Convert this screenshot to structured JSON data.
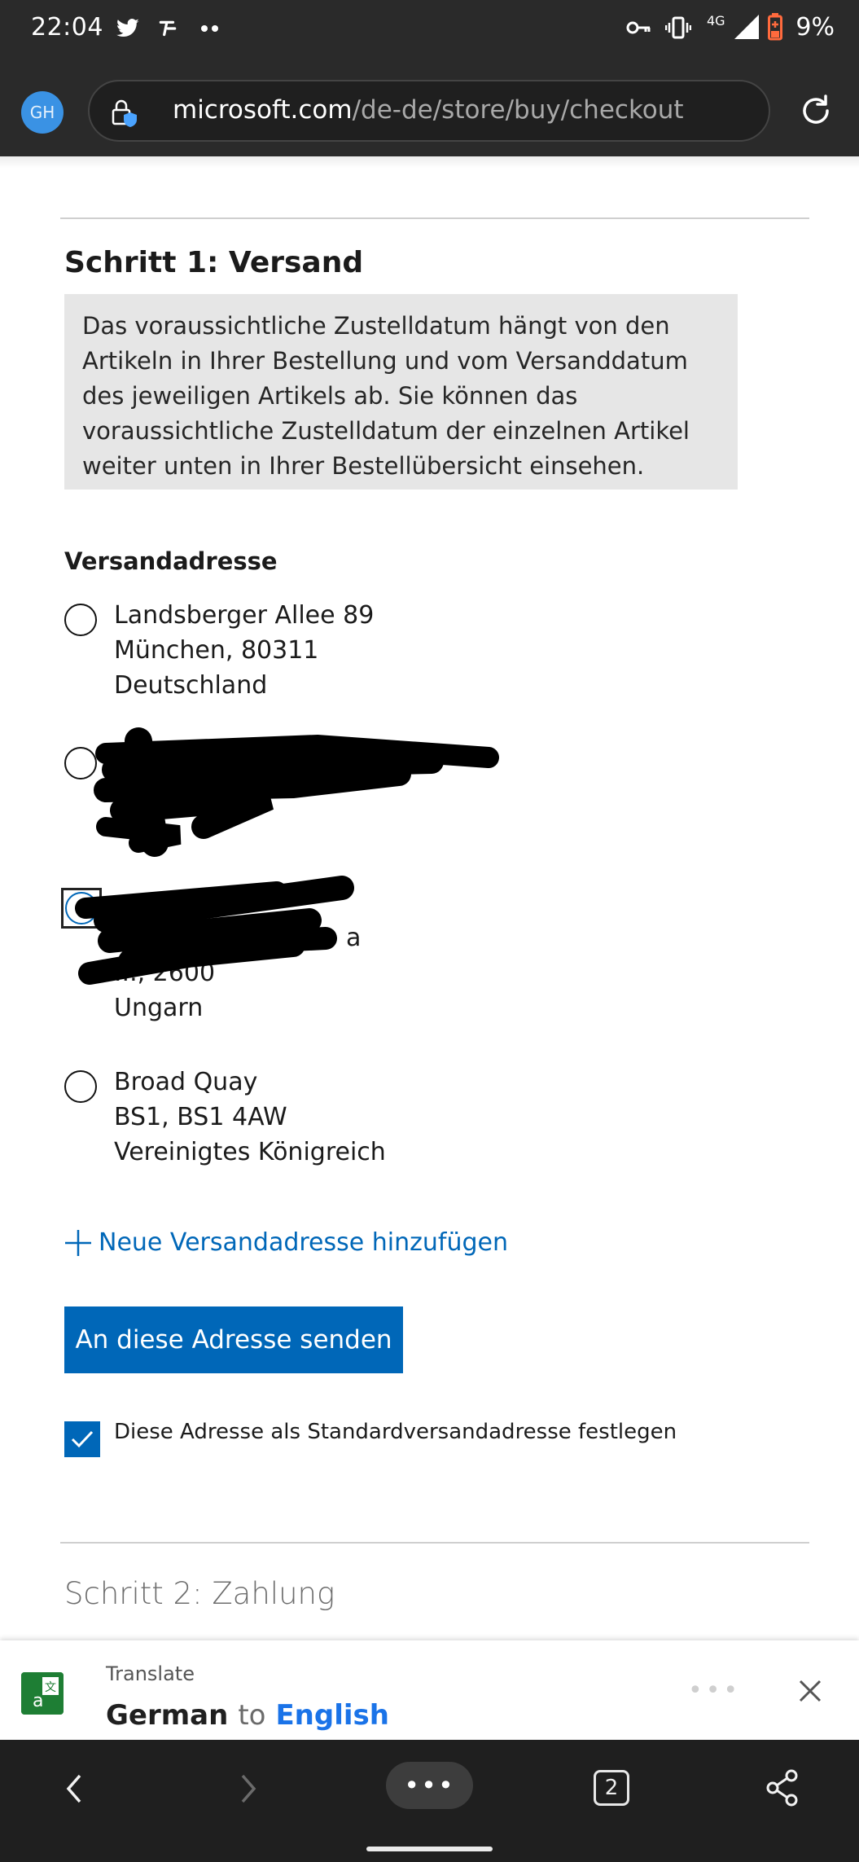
{
  "status_bar": {
    "time": "22:04",
    "network": "4G",
    "battery": "9%",
    "icons": [
      "twitter-icon",
      "app-icon",
      "more-dots-icon",
      "key-icon",
      "vibrate-icon",
      "signal-icon",
      "battery-icon"
    ]
  },
  "browser": {
    "avatar_initials": "GH",
    "url_domain": "microsoft.com",
    "url_path": "/de-de/store/buy/checkout",
    "icons": [
      "lock-icon",
      "reload-icon"
    ]
  },
  "checkout": {
    "step1_title": "Schritt 1: Versand",
    "notice": "Das voraussichtliche Zustelldatum hängt von den Artikeln in Ihrer Bestellung und vom Versanddatum des jeweiligen Artikels ab. Sie können das voraussichtliche Zustelldatum der einzelnen Artikel weiter unten in Ihrer Bestellübersicht einsehen.",
    "shipping_label": "Versandadresse",
    "addresses": [
      {
        "line1": "Landsberger Allee 89",
        "line2": "München, 80311",
        "line3": "Deutschland"
      },
      {
        "line1": "",
        "line2": "",
        "line3": ""
      },
      {
        "line1": "",
        "line2": "a",
        "line3": "..., 2600",
        "line4": "Ungarn"
      },
      {
        "line1": "Broad Quay",
        "line2": "BS1, BS1 4AW",
        "line3": "Vereinigtes Königreich"
      }
    ],
    "add_address": "Neue Versandadresse hinzufügen",
    "send_button": "An diese Adresse senden",
    "default_checkbox_label": "Diese Adresse als Standardversandadresse festlegen",
    "default_checked": true,
    "step2_title": "Schritt 2: Zahlung"
  },
  "translate_bar": {
    "title": "Translate",
    "from": "German",
    "to_word": "to",
    "to": "English"
  },
  "bottom_nav": {
    "tab_count": "2",
    "menu_label": "•••"
  },
  "colors": {
    "accent": "#0067b8",
    "chrome": "#2a2a2a",
    "notice_bg": "#e6e6e6"
  }
}
